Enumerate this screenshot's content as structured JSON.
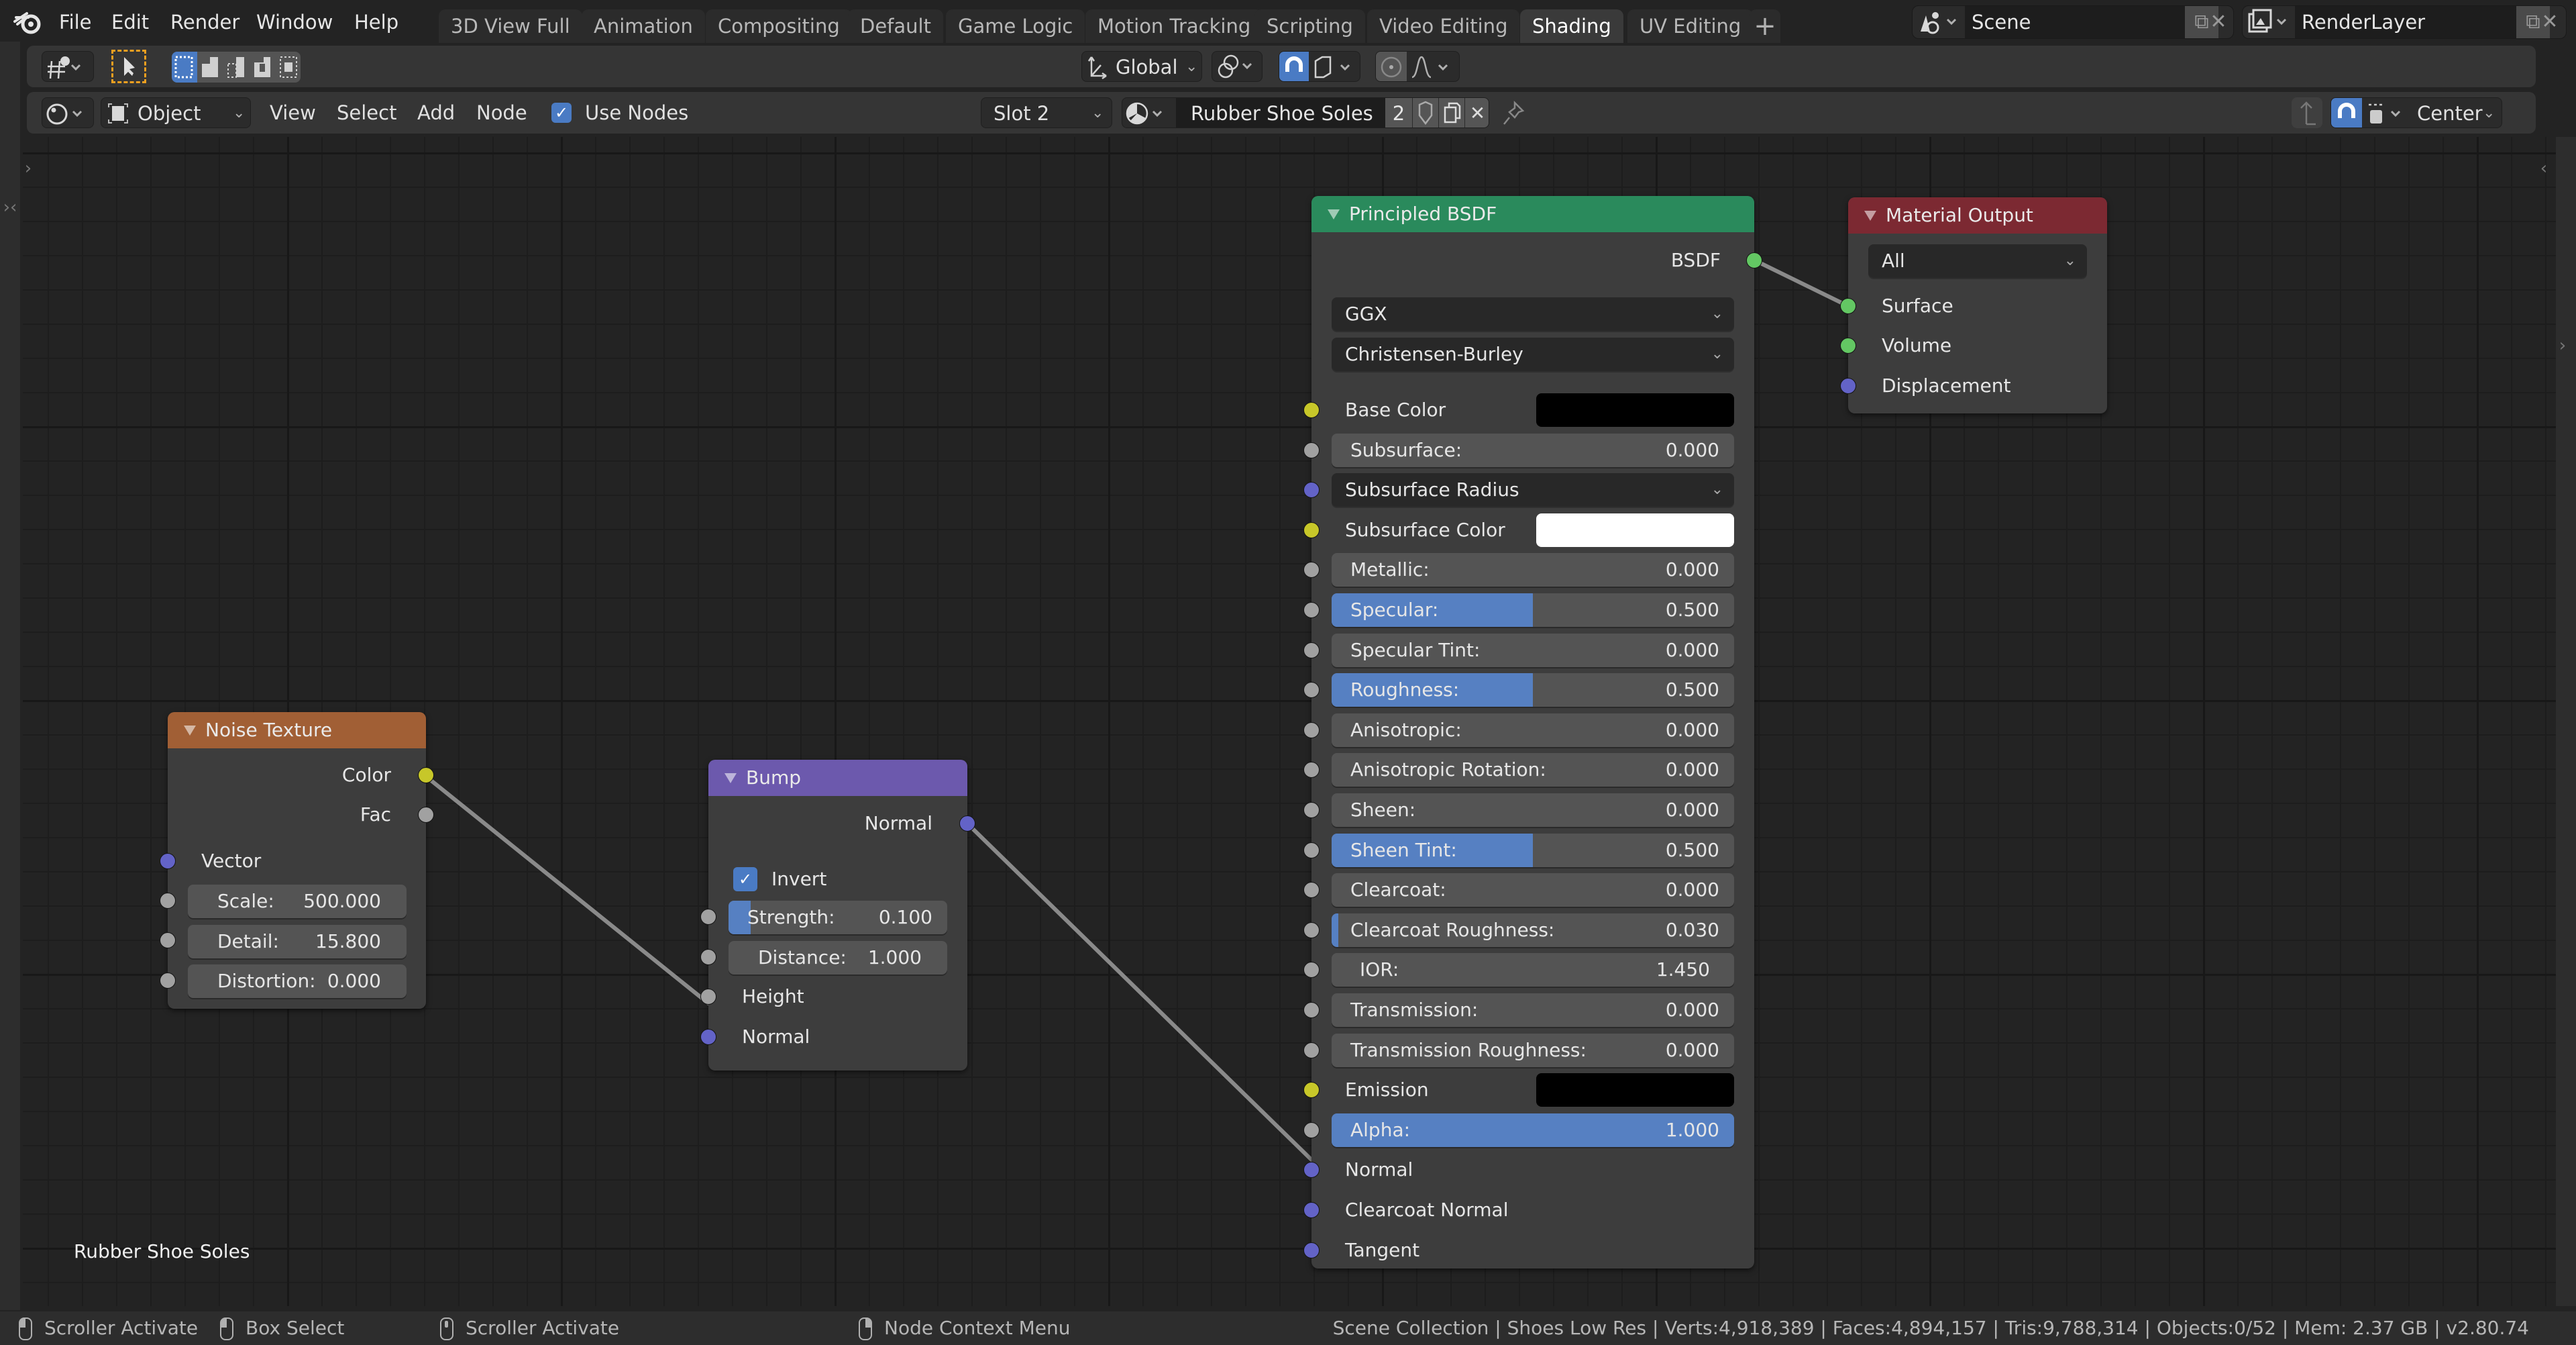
{
  "topbar": {
    "menus": [
      "File",
      "Edit",
      "Render",
      "Window",
      "Help"
    ],
    "workspace_tabs": [
      "3D View Full",
      "Animation",
      "Compositing",
      "Default",
      "Game Logic",
      "Motion Tracking",
      "Scripting",
      "Video Editing",
      "Shading",
      "UV Editing"
    ],
    "active_tab": "Shading",
    "add_tab_label": "+",
    "scene": {
      "icon": "scene-icon",
      "name": "Scene"
    },
    "view_layer": {
      "icon": "render-layer-icon",
      "name": "RenderLayer"
    }
  },
  "tool_header": {
    "editor_icon": "node-editor-icon",
    "active_tool": "select-tool",
    "select_modes": [
      "set",
      "extend",
      "subtract",
      "difference",
      "intersect"
    ],
    "transform_orientation": "Global",
    "pivot_icon": "pivot-icon",
    "snap_active": true,
    "proportional_icon": "proportional-falloff-icon"
  },
  "node_header": {
    "shader_type_icon": "shader-icon",
    "object_type": "Object",
    "menus": [
      "View",
      "Select",
      "Add",
      "Node"
    ],
    "use_nodes_label": "Use Nodes",
    "use_nodes_checked": true,
    "slot": "Slot 2",
    "material_name": "Rubber Shoe Soles",
    "material_users": "2",
    "snap_label": "Center"
  },
  "nodes": {
    "noise": {
      "title": "Noise Texture",
      "header_color": "#a15f35",
      "outputs": [
        {
          "label": "Color",
          "socket": "yellow"
        },
        {
          "label": "Fac",
          "socket": "grey"
        }
      ],
      "vector_label": "Vector",
      "fields": [
        {
          "label": "Scale:",
          "value": "500.000"
        },
        {
          "label": "Detail:",
          "value": "15.800"
        },
        {
          "label": "Distortion:",
          "value": "0.000"
        }
      ]
    },
    "bump": {
      "title": "Bump",
      "header_color": "#6c59ad",
      "output_label": "Normal",
      "invert_label": "Invert",
      "invert_checked": true,
      "fields": [
        {
          "label": "Strength:",
          "value": "0.100",
          "fill": 0.1
        },
        {
          "label": "Distance:",
          "value": "1.000",
          "fill": 0
        }
      ],
      "inputs": [
        "Height",
        "Normal"
      ]
    },
    "bsdf": {
      "title": "Principled BSDF",
      "header_color": "#2a8a5c",
      "output_label": "BSDF",
      "distribution": "GGX",
      "subsurface_method": "Christensen-Burley",
      "rows": [
        {
          "type": "color",
          "label": "Base Color",
          "socket": "yellow",
          "color": "#000000"
        },
        {
          "type": "value",
          "label": "Subsurface:",
          "value": "0.000",
          "fill": 0,
          "socket": "grey"
        },
        {
          "type": "dropdown",
          "label": "Subsurface Radius",
          "socket": "blue"
        },
        {
          "type": "color",
          "label": "Subsurface Color",
          "socket": "yellow",
          "color": "#ffffff"
        },
        {
          "type": "value",
          "label": "Metallic:",
          "value": "0.000",
          "fill": 0,
          "socket": "grey"
        },
        {
          "type": "value",
          "label": "Specular:",
          "value": "0.500",
          "fill": 0.5,
          "socket": "grey"
        },
        {
          "type": "value",
          "label": "Specular Tint:",
          "value": "0.000",
          "fill": 0,
          "socket": "grey"
        },
        {
          "type": "value",
          "label": "Roughness:",
          "value": "0.500",
          "fill": 0.5,
          "socket": "grey"
        },
        {
          "type": "value",
          "label": "Anisotropic:",
          "value": "0.000",
          "fill": 0,
          "socket": "grey"
        },
        {
          "type": "value",
          "label": "Anisotropic Rotation:",
          "value": "0.000",
          "fill": 0,
          "socket": "grey"
        },
        {
          "type": "value",
          "label": "Sheen:",
          "value": "0.000",
          "fill": 0,
          "socket": "grey"
        },
        {
          "type": "value",
          "label": "Sheen Tint:",
          "value": "0.500",
          "fill": 0.5,
          "socket": "grey"
        },
        {
          "type": "value",
          "label": "Clearcoat:",
          "value": "0.000",
          "fill": 0,
          "socket": "grey"
        },
        {
          "type": "value",
          "label": "Clearcoat Roughness:",
          "value": "0.030",
          "fill": 0.03,
          "socket": "grey"
        },
        {
          "type": "value",
          "label": "IOR:",
          "value": "1.450",
          "fill": 0,
          "socket": "grey"
        },
        {
          "type": "value",
          "label": "Transmission:",
          "value": "0.000",
          "fill": 0,
          "socket": "grey"
        },
        {
          "type": "value",
          "label": "Transmission Roughness:",
          "value": "0.000",
          "fill": 0,
          "socket": "grey"
        },
        {
          "type": "color",
          "label": "Emission",
          "socket": "yellow",
          "color": "#000000"
        },
        {
          "type": "value",
          "label": "Alpha:",
          "value": "1.000",
          "fill": 1,
          "socket": "grey"
        },
        {
          "type": "socket",
          "label": "Normal",
          "socket": "blue"
        },
        {
          "type": "socket",
          "label": "Clearcoat Normal",
          "socket": "blue"
        },
        {
          "type": "socket",
          "label": "Tangent",
          "socket": "blue"
        }
      ]
    },
    "output": {
      "title": "Material Output",
      "header_color": "#7c2932",
      "target": "All",
      "inputs": [
        {
          "label": "Surface",
          "socket": "green"
        },
        {
          "label": "Volume",
          "socket": "green"
        },
        {
          "label": "Displacement",
          "socket": "blue"
        }
      ]
    }
  },
  "links": [
    {
      "from": "Noise Texture.Color",
      "to": "Bump.Height"
    },
    {
      "from": "Bump.Normal",
      "to": "Principled BSDF.Normal"
    },
    {
      "from": "Principled BSDF.BSDF",
      "to": "Material Output.Surface"
    }
  ],
  "canvas_label": "Rubber Shoe Soles",
  "statusbar": {
    "hints": [
      {
        "icon": "mouse-left-icon",
        "label": "Scroller Activate"
      },
      {
        "icon": "mouse-left-drag-icon",
        "label": "Box Select"
      },
      {
        "icon": "mouse-middle-icon",
        "label": "Scroller Activate"
      },
      {
        "icon": "mouse-right-icon",
        "label": "Node Context Menu"
      }
    ],
    "stats": "Scene Collection | Shoes Low Res | Verts:4,918,389 | Faces:4,894,157 | Tris:9,788,314 | Objects:0/52 | Mem: 2.37 GB | v2.80.74"
  },
  "colors": {
    "accent": "#5680c2",
    "socket_grey": "#a1a1a1",
    "socket_yellow": "#c7c729",
    "socket_blue": "#6363c7",
    "socket_green": "#63c763"
  }
}
